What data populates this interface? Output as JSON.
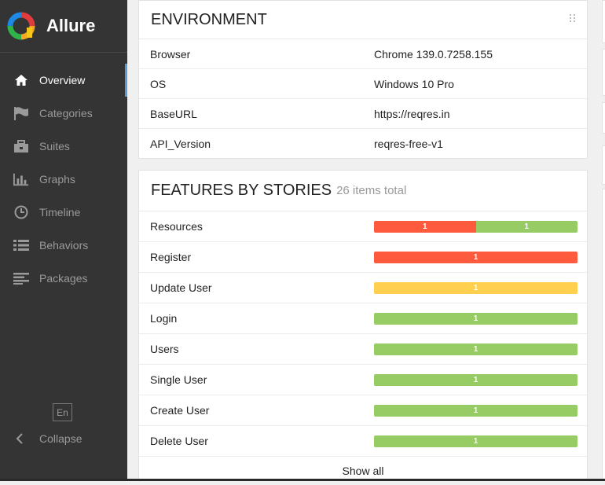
{
  "app": {
    "name": "Allure"
  },
  "sidebar": {
    "items": [
      {
        "label": "Overview",
        "icon": "home-icon",
        "active": true
      },
      {
        "label": "Categories",
        "icon": "flag-icon",
        "active": false
      },
      {
        "label": "Suites",
        "icon": "briefcase-icon",
        "active": false
      },
      {
        "label": "Graphs",
        "icon": "bar-chart-icon",
        "active": false
      },
      {
        "label": "Timeline",
        "icon": "clock-icon",
        "active": false
      },
      {
        "label": "Behaviors",
        "icon": "list-icon",
        "active": false
      },
      {
        "label": "Packages",
        "icon": "align-left-icon",
        "active": false
      }
    ],
    "language": "En",
    "collapse_label": "Collapse"
  },
  "environment": {
    "title": "ENVIRONMENT",
    "rows": [
      {
        "key": "Browser",
        "value": "Chrome 139.0.7258.155"
      },
      {
        "key": "OS",
        "value": "Windows 10 Pro"
      },
      {
        "key": "BaseURL",
        "value": "https://reqres.in"
      },
      {
        "key": "API_Version",
        "value": "reqres-free-v1"
      }
    ]
  },
  "features": {
    "title": "FEATURES BY STORIES",
    "subtitle": "26 items total",
    "rows": [
      {
        "name": "Resources",
        "segments": [
          {
            "status": "failed",
            "count": "1"
          },
          {
            "status": "passed",
            "count": "1"
          }
        ]
      },
      {
        "name": "Register",
        "segments": [
          {
            "status": "failed",
            "count": "1"
          }
        ]
      },
      {
        "name": "Update User",
        "segments": [
          {
            "status": "broken",
            "count": "1"
          }
        ]
      },
      {
        "name": "Login",
        "segments": [
          {
            "status": "passed",
            "count": "1"
          }
        ]
      },
      {
        "name": "Users",
        "segments": [
          {
            "status": "passed",
            "count": "1"
          }
        ]
      },
      {
        "name": "Single User",
        "segments": [
          {
            "status": "passed",
            "count": "1"
          }
        ]
      },
      {
        "name": "Create User",
        "segments": [
          {
            "status": "passed",
            "count": "1"
          }
        ]
      },
      {
        "name": "Delete User",
        "segments": [
          {
            "status": "passed",
            "count": "1"
          }
        ]
      }
    ],
    "show_all_label": "Show all"
  },
  "colors": {
    "failed": "#fd5a3e",
    "passed": "#97cc64",
    "broken": "#ffd050",
    "sidebar_bg": "#343434",
    "active_indicator": "#5a9bd5"
  }
}
